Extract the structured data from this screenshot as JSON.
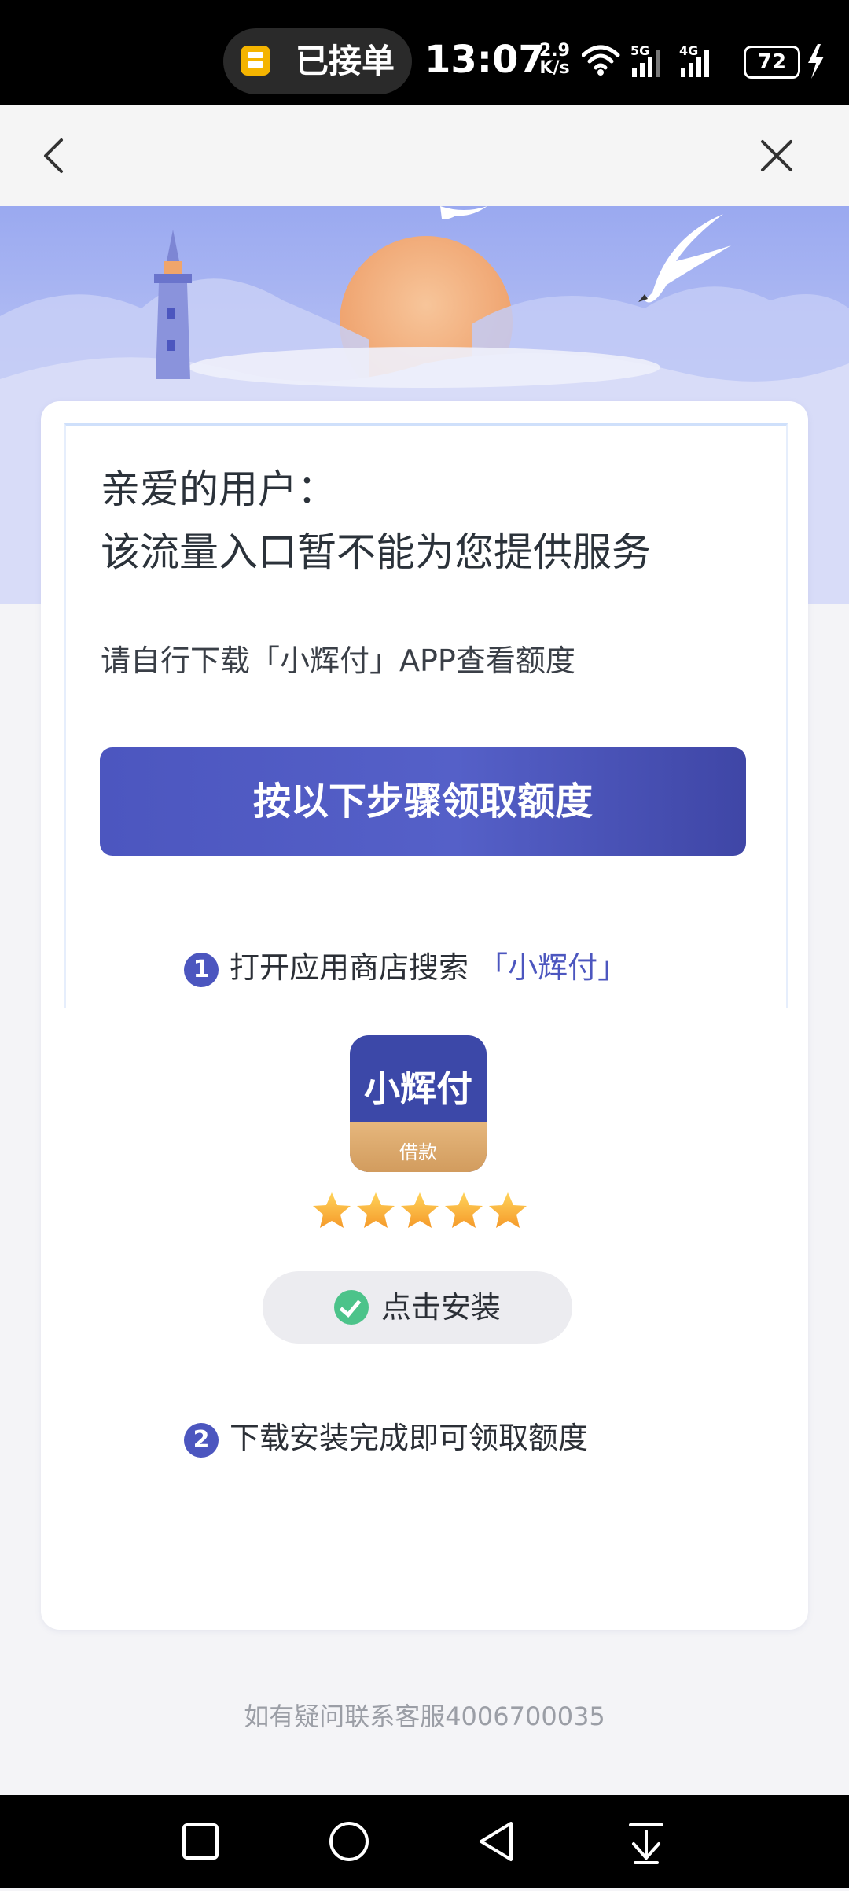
{
  "status_bar": {
    "order_pill": "已接单",
    "time": "13:07",
    "net_speed_value": "2.9",
    "net_speed_unit": "K/s",
    "signal_1": "5G",
    "signal_2": "4G",
    "battery": "72"
  },
  "greeting": {
    "line1": "亲爱的用户：",
    "line2": "该流量入口暂不能为您提供服务"
  },
  "note": "请自行下载「小辉付」APP查看额度",
  "main_button": "按以下步骤领取额度",
  "steps": [
    {
      "num": "1",
      "text": "打开应用商店搜索",
      "highlight": "「小辉付」"
    },
    {
      "num": "2",
      "text": "下载安装完成即可领取额度",
      "highlight": ""
    }
  ],
  "app": {
    "name": "小辉付",
    "sub": "借款",
    "rating": 5
  },
  "install_button": "点击安装",
  "contact": "如有疑问联系客服4006700035",
  "colors": {
    "accent": "#4c56bf",
    "hero_sky": "#9aa9f0",
    "check_green": "#4cc38a",
    "sun": "#f0a56b"
  }
}
